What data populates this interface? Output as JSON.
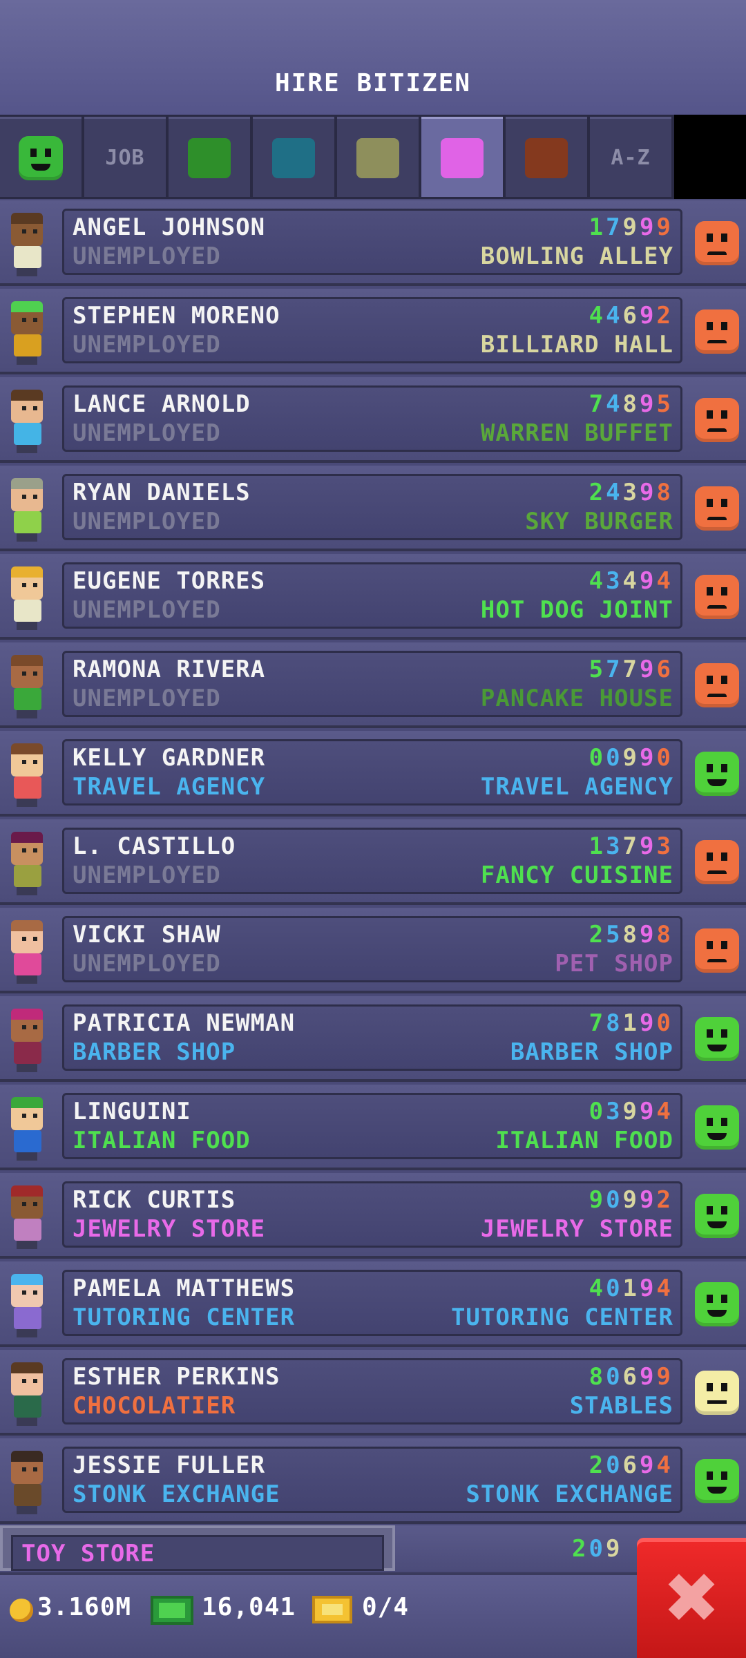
{
  "header": {
    "title": "HIRE BITIZEN"
  },
  "tabs": [
    {
      "type": "face",
      "mood": "happy",
      "color": "#39b83a"
    },
    {
      "type": "text",
      "label": "JOB"
    },
    {
      "type": "swatch",
      "color": "#2e8f2a"
    },
    {
      "type": "swatch",
      "color": "#1f6f86"
    },
    {
      "type": "swatch",
      "color": "#8e8f5c"
    },
    {
      "type": "swatch",
      "color": "#e063e6",
      "selected": true
    },
    {
      "type": "swatch",
      "color": "#84391e"
    },
    {
      "type": "text",
      "label": "A-Z"
    }
  ],
  "residents": [
    {
      "name": "ANGEL JOHNSON",
      "job": "UNEMPLOYED",
      "job_color": "#7a7a96",
      "id": "17999",
      "dream": "BOWLING ALLEY",
      "dream_color": "#d8d6a0",
      "mood": "sad",
      "skin": "#8a5a34",
      "hair": "#5a3a22",
      "shirt": "#e8e6c8"
    },
    {
      "name": "STEPHEN MORENO",
      "job": "UNEMPLOYED",
      "job_color": "#7a7a96",
      "id": "44692",
      "dream": "BILLIARD HALL",
      "dream_color": "#d8d6a0",
      "mood": "sad",
      "skin": "#8a5a34",
      "hair": "#4fd150",
      "shirt": "#d9a020"
    },
    {
      "name": "LANCE ARNOLD",
      "job": "UNEMPLOYED",
      "job_color": "#7a7a96",
      "id": "74895",
      "dream": "WARREN BUFFET",
      "dream_color": "#5aa83a",
      "mood": "sad",
      "skin": "#e8b890",
      "hair": "#5a3a22",
      "shirt": "#44b4e6"
    },
    {
      "name": "RYAN DANIELS",
      "job": "UNEMPLOYED",
      "job_color": "#7a7a96",
      "id": "24398",
      "dream": "SKY BURGER",
      "dream_color": "#5aa83a",
      "mood": "sad",
      "skin": "#e8b890",
      "hair": "#9aa08a",
      "shirt": "#8fd14a"
    },
    {
      "name": "EUGENE TORRES",
      "job": "UNEMPLOYED",
      "job_color": "#7a7a96",
      "id": "43494",
      "dream": "HOT DOG JOINT",
      "dream_color": "#4fe04f",
      "mood": "sad",
      "skin": "#f0c898",
      "hair": "#e8b030",
      "shirt": "#e8e6c8"
    },
    {
      "name": "RAMONA RIVERA",
      "job": "UNEMPLOYED",
      "job_color": "#7a7a96",
      "id": "57796",
      "dream": "PANCAKE HOUSE",
      "dream_color": "#4a9a36",
      "mood": "sad",
      "skin": "#a86a44",
      "hair": "#7a4a2a",
      "shirt": "#3aa83a"
    },
    {
      "name": "KELLY GARDNER",
      "job": "TRAVEL AGENCY",
      "job_color": "#4ab4ee",
      "id": "00990",
      "dream": "TRAVEL AGENCY",
      "dream_color": "#4ab4ee",
      "mood": "happy",
      "skin": "#f0c898",
      "hair": "#7a4a2a",
      "shirt": "#e85858"
    },
    {
      "name": "L. CASTILLO",
      "job": "UNEMPLOYED",
      "job_color": "#7a7a96",
      "id": "13793",
      "dream": "FANCY CUISINE",
      "dream_color": "#4fe04f",
      "mood": "sad",
      "skin": "#c89060",
      "hair": "#6a1a4a",
      "shirt": "#9aa040"
    },
    {
      "name": "VICKI SHAW",
      "job": "UNEMPLOYED",
      "job_color": "#7a7a96",
      "id": "25898",
      "dream": "PET SHOP",
      "dream_color": "#a060b0",
      "mood": "sad",
      "skin": "#f0c0a0",
      "hair": "#a86a44",
      "shirt": "#e04a9a"
    },
    {
      "name": "PATRICIA NEWMAN",
      "job": "BARBER SHOP",
      "job_color": "#4ab4ee",
      "id": "78190",
      "dream": "BARBER SHOP",
      "dream_color": "#4ab4ee",
      "mood": "happy",
      "skin": "#a86a44",
      "hair": "#c02a7a",
      "shirt": "#8a2a4a"
    },
    {
      "name": "LINGUINI",
      "job": "ITALIAN FOOD",
      "job_color": "#4fe04f",
      "id": "03994",
      "dream": "ITALIAN FOOD",
      "dream_color": "#4fe04f",
      "mood": "happy",
      "skin": "#f0c898",
      "hair": "#3aa83a",
      "shirt": "#2a6ad0"
    },
    {
      "name": "RICK CURTIS",
      "job": "JEWELRY STORE",
      "job_color": "#e86ae8",
      "id": "90992",
      "dream": "JEWELRY STORE",
      "dream_color": "#e86ae8",
      "mood": "happy",
      "skin": "#8a5a34",
      "hair": "#a02a2a",
      "shirt": "#c080c0"
    },
    {
      "name": "PAMELA MATTHEWS",
      "job": "TUTORING CENTER",
      "job_color": "#4ab4ee",
      "id": "40194",
      "dream": "TUTORING CENTER",
      "dream_color": "#4ab4ee",
      "mood": "happy",
      "skin": "#f0c8b0",
      "hair": "#4ab4ee",
      "shirt": "#8a6ad0"
    },
    {
      "name": "ESTHER PERKINS",
      "job": "CHOCOLATIER",
      "job_color": "#f07040",
      "id": "80699",
      "dream": "STABLES",
      "dream_color": "#4ab4ee",
      "mood": "meh",
      "skin": "#f0c0a0",
      "hair": "#5a3a22",
      "shirt": "#2a6a4a"
    },
    {
      "name": "JESSIE FULLER",
      "job": "STONK EXCHANGE",
      "job_color": "#4ab4ee",
      "id": "20694",
      "dream": "STONK EXCHANGE",
      "dream_color": "#4ab4ee",
      "mood": "happy",
      "skin": "#a86a44",
      "hair": "#3a2a22",
      "shirt": "#6a4a2a"
    }
  ],
  "partial_row": {
    "job": "TOY STORE",
    "id": "209"
  },
  "mood_colors": {
    "happy": "#4fd13a",
    "sad": "#f07040",
    "meh": "#f4eda6"
  },
  "bottom_bar": {
    "coins": "3.160M",
    "bux": "16,041",
    "tickets": "0/4"
  },
  "close_button": {
    "symbol": "✖"
  }
}
